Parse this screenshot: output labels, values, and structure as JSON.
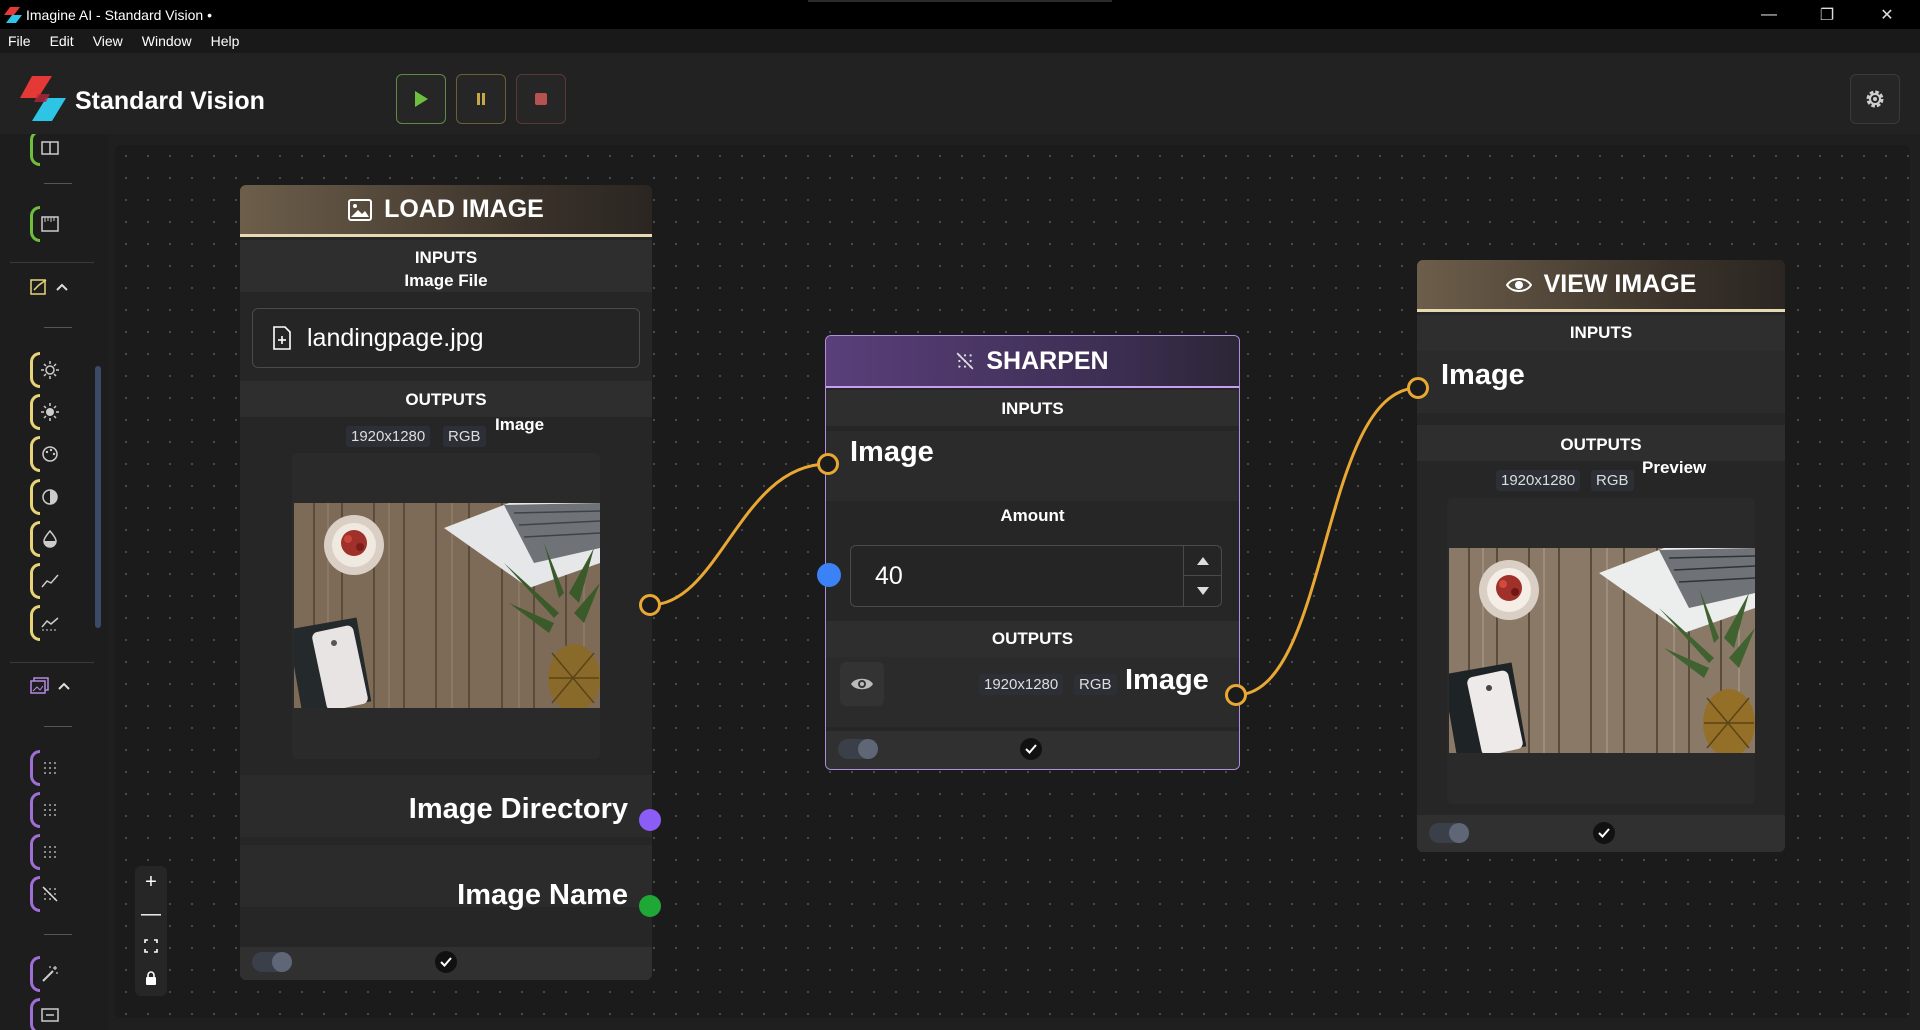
{
  "window": {
    "title": "Imagine AI - Standard Vision •",
    "minimize": "—",
    "restore": "❐",
    "close": "✕"
  },
  "menu": [
    "File",
    "Edit",
    "View",
    "Window",
    "Help"
  ],
  "header": {
    "brand": "Standard Vision",
    "controls": [
      "play",
      "pause",
      "stop"
    ]
  },
  "colors": {
    "accent_orange": "#e9a834",
    "accent_green": "#6fbf3f",
    "accent_yellow": "#e8d37a",
    "accent_purple": "#a06fd6",
    "port_purple": "#8b5cf6",
    "port_green": "#1fa836",
    "port_blue": "#3b82f6"
  },
  "sidebar": {
    "groups": [
      {
        "icons": [
          "grid-icon",
          "ruler-icon"
        ],
        "color": "green"
      },
      {
        "section_icon": "adjust-icon",
        "icons": [
          "brightness-icon",
          "brightness-alt-icon",
          "palette-icon",
          "contrast-icon",
          "drop-icon",
          "curve-icon",
          "levels-icon"
        ],
        "color": "yellow"
      },
      {
        "section_icon": "image-stack-icon",
        "icons": [
          "dots-icon",
          "dots-alt-icon",
          "dots-grid-icon",
          "sharpen-icon"
        ],
        "color": "purple"
      },
      {
        "icons": [
          "wand-icon",
          "crop-icon"
        ],
        "color": "purple"
      }
    ]
  },
  "zoom": {
    "in": "+",
    "out": "—"
  },
  "nodes": {
    "load_image": {
      "title": "LOAD IMAGE",
      "inputs_label": "INPUTS",
      "input_name": "Image File",
      "file_value": "landingpage.jpg",
      "outputs_label": "OUTPUTS",
      "resolution": "1920x1280",
      "mode": "RGB",
      "output_name": "Image",
      "directory_label": "Image Directory",
      "name_label": "Image Name"
    },
    "sharpen": {
      "title": "SHARPEN",
      "inputs_label": "INPUTS",
      "input_name": "Image",
      "amount_label": "Amount",
      "amount_value": "40",
      "outputs_label": "OUTPUTS",
      "resolution": "1920x1280",
      "mode": "RGB",
      "output_name": "Image"
    },
    "view_image": {
      "title": "VIEW IMAGE",
      "inputs_label": "INPUTS",
      "input_name": "Image",
      "outputs_label": "OUTPUTS",
      "resolution": "1920x1280",
      "mode": "RGB",
      "output_name": "Preview"
    }
  }
}
